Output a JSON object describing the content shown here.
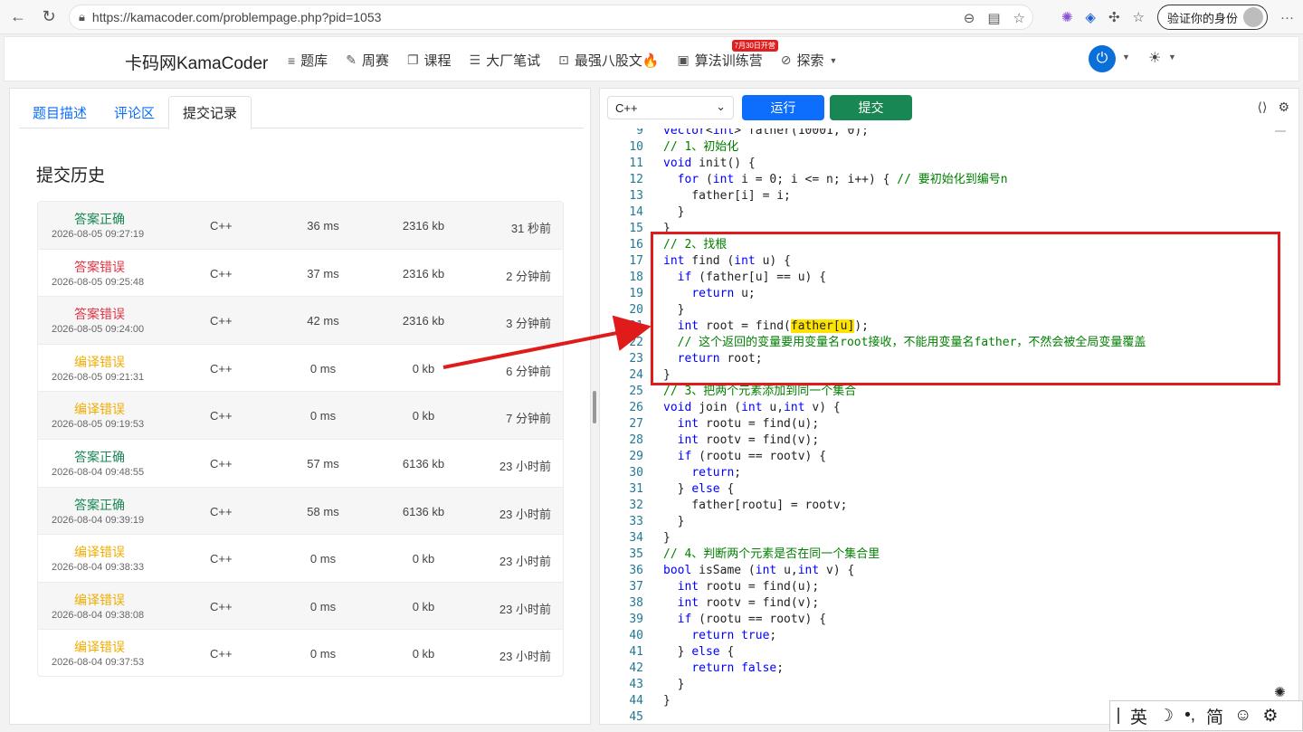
{
  "browser": {
    "url": "https://kamacoder.com/problempage.php?pid=1053",
    "profile_label": "验证你的身份"
  },
  "site_nav": {
    "brand": "卡码网KamaCoder",
    "items": [
      {
        "label": "题库",
        "icon": "≡"
      },
      {
        "label": "周赛",
        "icon": "✎"
      },
      {
        "label": "课程",
        "icon": "❐"
      },
      {
        "label": "大厂笔试",
        "icon": "☰"
      },
      {
        "label": "最强八股文🔥",
        "icon": "⊡"
      },
      {
        "label": "算法训练营",
        "icon": "▣"
      },
      {
        "label": "探索",
        "icon": "⊘"
      }
    ],
    "badge": "7月30日开营"
  },
  "left": {
    "tabs": [
      "题目描述",
      "评论区",
      "提交记录"
    ],
    "title": "提交历史",
    "records": [
      {
        "status": "答案正确",
        "kind": "ok",
        "date": "2026-08-05 09:27:19",
        "lang": "C++",
        "time": "36 ms",
        "mem": "2316 kb",
        "ago": "31 秒前"
      },
      {
        "status": "答案错误",
        "kind": "wa",
        "date": "2026-08-05 09:25:48",
        "lang": "C++",
        "time": "37 ms",
        "mem": "2316 kb",
        "ago": "2 分钟前"
      },
      {
        "status": "答案错误",
        "kind": "wa",
        "date": "2026-08-05 09:24:00",
        "lang": "C++",
        "time": "42 ms",
        "mem": "2316 kb",
        "ago": "3 分钟前"
      },
      {
        "status": "编译错误",
        "kind": "ce",
        "date": "2026-08-05 09:21:31",
        "lang": "C++",
        "time": "0 ms",
        "mem": "0 kb",
        "ago": "6 分钟前"
      },
      {
        "status": "编译错误",
        "kind": "ce",
        "date": "2026-08-05 09:19:53",
        "lang": "C++",
        "time": "0 ms",
        "mem": "0 kb",
        "ago": "7 分钟前"
      },
      {
        "status": "答案正确",
        "kind": "ok",
        "date": "2026-08-04 09:48:55",
        "lang": "C++",
        "time": "57 ms",
        "mem": "6136 kb",
        "ago": "23 小时前"
      },
      {
        "status": "答案正确",
        "kind": "ok",
        "date": "2026-08-04 09:39:19",
        "lang": "C++",
        "time": "58 ms",
        "mem": "6136 kb",
        "ago": "23 小时前"
      },
      {
        "status": "编译错误",
        "kind": "ce",
        "date": "2026-08-04 09:38:33",
        "lang": "C++",
        "time": "0 ms",
        "mem": "0 kb",
        "ago": "23 小时前"
      },
      {
        "status": "编译错误",
        "kind": "ce",
        "date": "2026-08-04 09:38:08",
        "lang": "C++",
        "time": "0 ms",
        "mem": "0 kb",
        "ago": "23 小时前"
      },
      {
        "status": "编译错误",
        "kind": "ce",
        "date": "2026-08-04 09:37:53",
        "lang": "C++",
        "time": "0 ms",
        "mem": "0 kb",
        "ago": "23 小时前"
      }
    ]
  },
  "editor": {
    "language": "C++",
    "run_label": "运行",
    "submit_label": "提交",
    "lines": [
      {
        "n": "9",
        "code": "vector<int> father(10001, 0);"
      },
      {
        "n": "10",
        "code": "// 1、初始化"
      },
      {
        "n": "11",
        "code": "void init() {"
      },
      {
        "n": "12",
        "code": "  for (int i = 0; i <= n; i++) { // 要初始化到编号n"
      },
      {
        "n": "13",
        "code": "    father[i] = i;"
      },
      {
        "n": "14",
        "code": "  }"
      },
      {
        "n": "15",
        "code": "}"
      },
      {
        "n": "16",
        "code": "// 2、找根"
      },
      {
        "n": "17",
        "code": "int find (int u) {"
      },
      {
        "n": "18",
        "code": "  if (father[u] == u) {"
      },
      {
        "n": "19",
        "code": "    return u;"
      },
      {
        "n": "20",
        "code": "  }"
      },
      {
        "n": "21",
        "code": "  int root = find(father[u]);"
      },
      {
        "n": "22",
        "code": "  // 这个返回的变量要用变量名root接收，不能用变量名father，不然会被全局变量覆盖"
      },
      {
        "n": "23",
        "code": "  return root;"
      },
      {
        "n": "24",
        "code": "}"
      },
      {
        "n": "25",
        "code": "// 3、把两个元素添加到同一个集合"
      },
      {
        "n": "26",
        "code": "void join (int u,int v) {"
      },
      {
        "n": "27",
        "code": "  int rootu = find(u);"
      },
      {
        "n": "28",
        "code": "  int rootv = find(v);"
      },
      {
        "n": "29",
        "code": "  if (rootu == rootv) {"
      },
      {
        "n": "30",
        "code": "    return;"
      },
      {
        "n": "31",
        "code": "  } else {"
      },
      {
        "n": "32",
        "code": "    father[rootu] = rootv;"
      },
      {
        "n": "33",
        "code": "  }"
      },
      {
        "n": "34",
        "code": "}"
      },
      {
        "n": "35",
        "code": "// 4、判断两个元素是否在同一个集合里"
      },
      {
        "n": "36",
        "code": "bool isSame (int u,int v) {"
      },
      {
        "n": "37",
        "code": "  int rootu = find(u);"
      },
      {
        "n": "38",
        "code": "  int rootv = find(v);"
      },
      {
        "n": "39",
        "code": "  if (rootu == rootv) {"
      },
      {
        "n": "40",
        "code": "    return true;"
      },
      {
        "n": "41",
        "code": "  } else {"
      },
      {
        "n": "42",
        "code": "    return false;"
      },
      {
        "n": "43",
        "code": "  }"
      },
      {
        "n": "44",
        "code": "}"
      },
      {
        "n": "45",
        "code": ""
      }
    ]
  },
  "ime": {
    "items": [
      "英",
      "☽",
      "•,",
      "简",
      "☺",
      "⚙"
    ]
  },
  "colors": {
    "primary": "#0d6efd",
    "success": "#198754",
    "danger": "#dc3545",
    "warning": "#f0ad00",
    "annotation": "#e01b1b",
    "highlight": "#ffe300"
  }
}
